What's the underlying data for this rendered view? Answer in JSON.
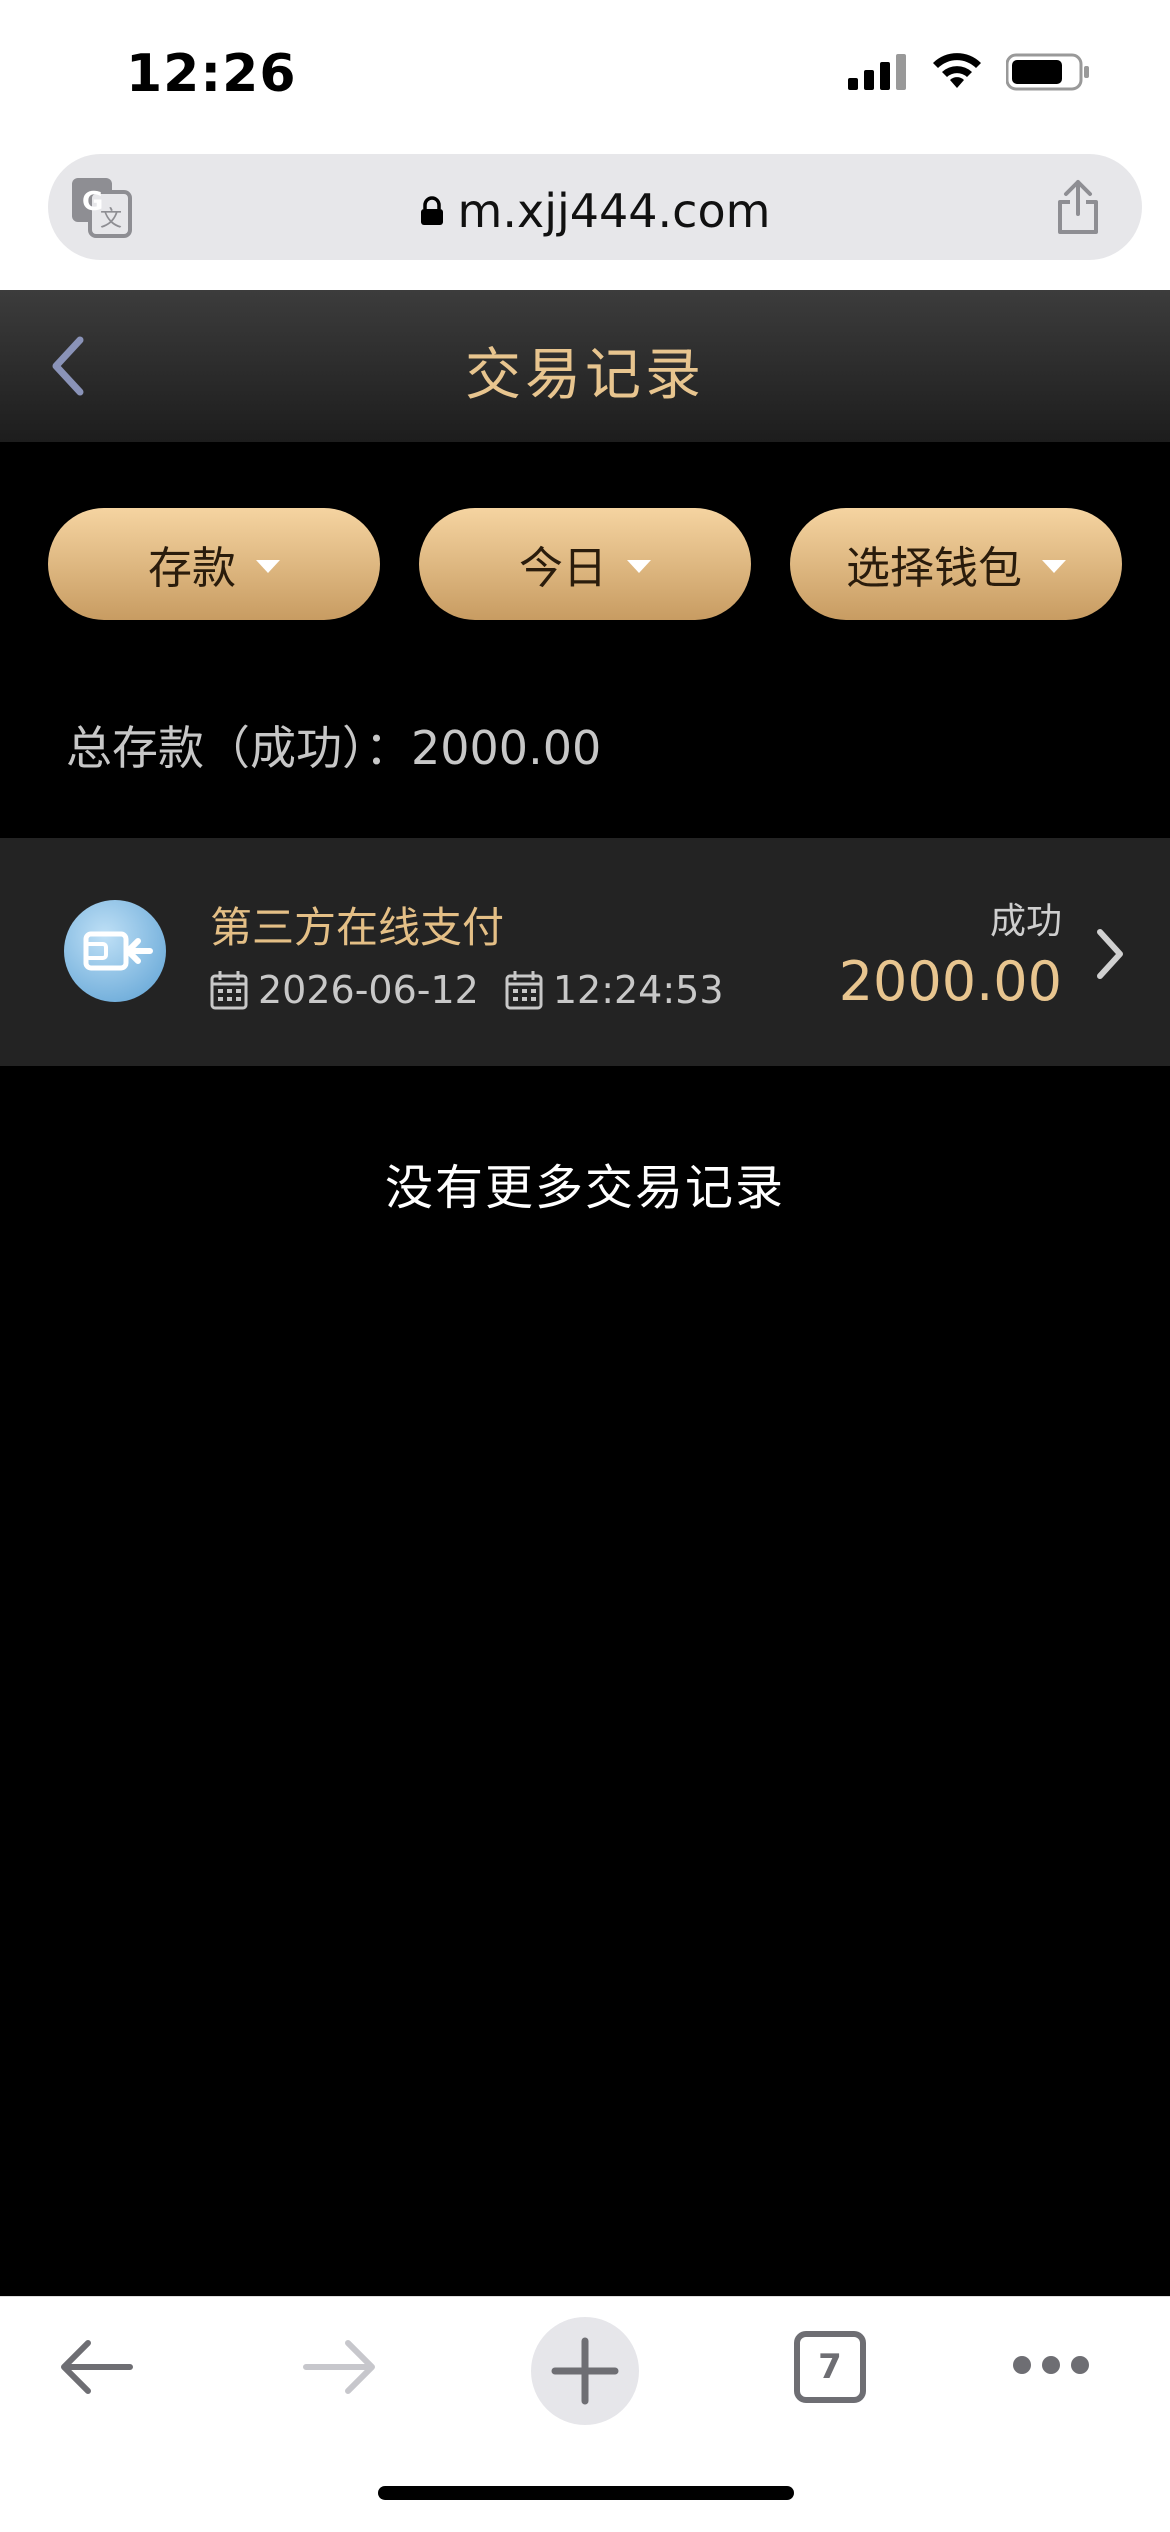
{
  "status_bar": {
    "time": "12:26"
  },
  "browser": {
    "url": "m.xjj444.com",
    "tab_count": "7"
  },
  "header": {
    "title": "交易记录"
  },
  "filters": [
    {
      "label": "存款"
    },
    {
      "label": "今日"
    },
    {
      "label": "选择钱包"
    }
  ],
  "summary": {
    "text": "总存款（成功）：2000.00"
  },
  "records": [
    {
      "title": "第三方在线支付",
      "date": "2026-06-12",
      "time": "12:24:53",
      "status": "成功",
      "amount": "2000.00"
    }
  ],
  "empty_text": "没有更多交易记录",
  "colors": {
    "gold": "#e8c58f",
    "pill_top": "#f5d4a1",
    "pill_bottom": "#c89c62"
  }
}
